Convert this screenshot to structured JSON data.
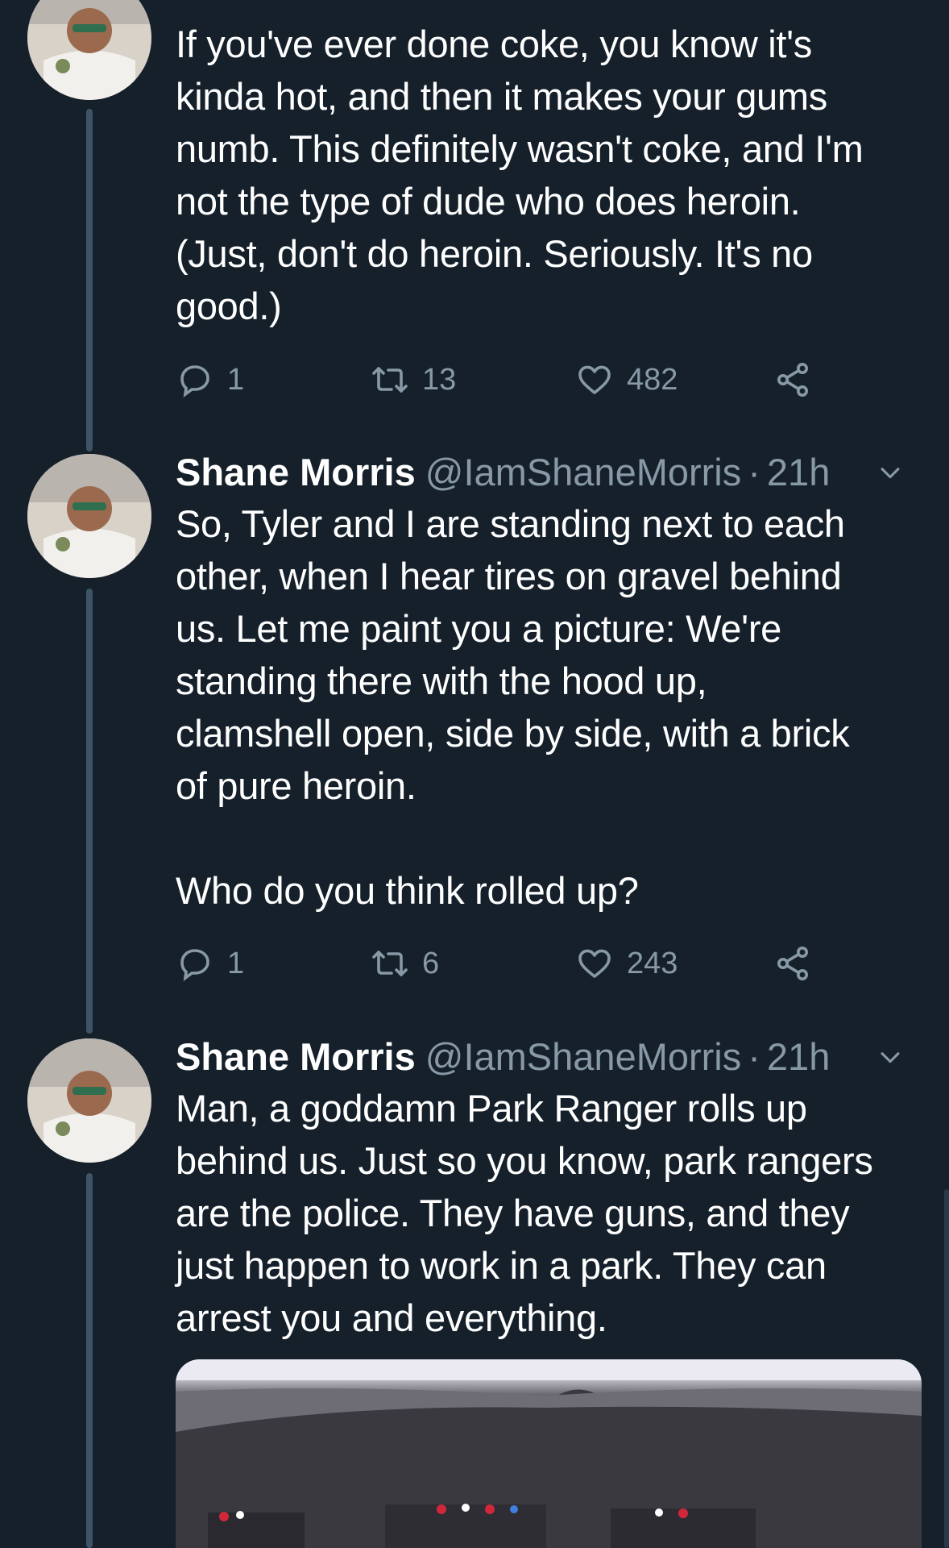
{
  "tweets": [
    {
      "text": "If you've ever done coke, you know it's\nkinda hot, and then it makes your gums\nnumb. This definitely wasn't coke, and I'm\nnot the type of dude who does heroin.\n(Just, don't do heroin. Seriously. It's no\ngood.)",
      "replies": "1",
      "retweets": "13",
      "likes": "482"
    },
    {
      "name": "Shane Morris",
      "handle": "@IamShaneMorris",
      "separator": "·",
      "time": "21h",
      "text": "So, Tyler and I are standing next to each\nother, when I hear tires on gravel behind\nus. Let me paint you a picture: We're\nstanding there with the hood up,\nclamshell open, side by side, with a brick\nof pure heroin.\n\nWho do you think rolled up?",
      "replies": "1",
      "retweets": "6",
      "likes": "243"
    },
    {
      "name": "Shane Morris",
      "handle": "@IamShaneMorris",
      "separator": "·",
      "time": "21h",
      "text": "Man, a goddamn Park Ranger rolls up\nbehind us. Just so you know, park rangers\nare the police. They have guns, and they\njust happen to work in a park. They can\narrest you and everything."
    }
  ],
  "colors": {
    "background": "#15202b",
    "secondary_text": "#8899a6",
    "thread_line": "#3d5466"
  },
  "icons": [
    "reply-icon",
    "retweet-icon",
    "like-icon",
    "share-icon",
    "caret-down-icon"
  ]
}
